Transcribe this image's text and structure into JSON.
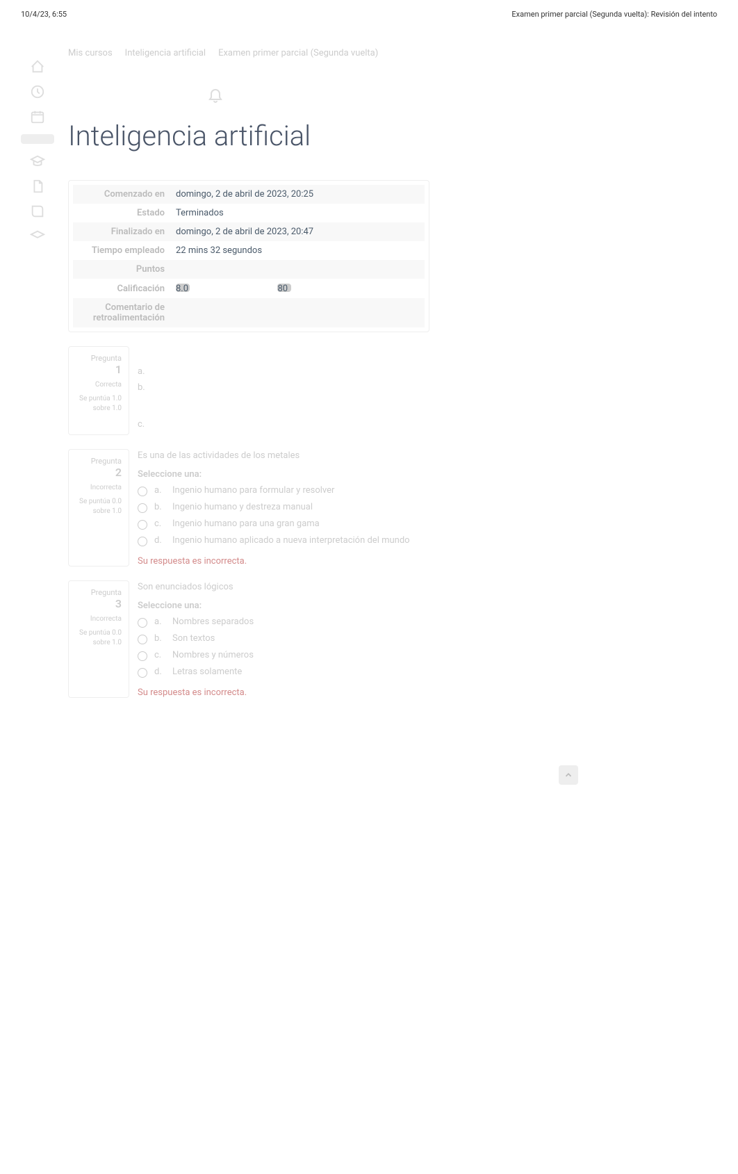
{
  "header": {
    "timestamp": "10/4/23, 6:55",
    "doc_title": "Examen primer parcial (Segunda vuelta): Revisión del intento"
  },
  "breadcrumbs": {
    "crumb1": "Mis cursos",
    "crumb2": "Inteligencia artificial",
    "crumb3": "Examen primer parcial (Segunda vuelta)"
  },
  "course": {
    "title": "Inteligencia artificial"
  },
  "summary": {
    "rows": [
      {
        "label": "Comenzado en",
        "value": "domingo, 2 de abril de 2023, 20:25"
      },
      {
        "label": "Estado",
        "value": "Terminados"
      },
      {
        "label": "Finalizado en",
        "value": "domingo, 2 de abril de 2023, 20:47"
      },
      {
        "label": "Tiempo empleado",
        "value": "22 mins 32 segundos"
      },
      {
        "label": "Puntos",
        "value": ""
      },
      {
        "label": "Calificación",
        "value1": "8.0",
        "value_mid": "",
        "value2": "80"
      },
      {
        "label": "Comentario de retroalimentación",
        "value": ""
      }
    ]
  },
  "q1": {
    "number": "1",
    "label": "Pregunta",
    "status1": "Correcta",
    "status2": "Se puntúa 1.0 sobre 1.0",
    "text_a": "a.",
    "text_b": "b.",
    "text_c": "c."
  },
  "q2": {
    "number": "2",
    "label": "Pregunta",
    "status1": "Incorrecta",
    "status2": "Se puntúa 0.0 sobre 1.0",
    "qtext": "Es una de las actividades de los metales",
    "heading": "Seleccione una:",
    "opts": {
      "a": {
        "let": "a.",
        "text": "Ingenio humano para formular y resolver"
      },
      "b": {
        "let": "b.",
        "text": "Ingenio humano y destreza manual"
      },
      "c": {
        "let": "c.",
        "text": "Ingenio humano para una gran gama"
      },
      "d": {
        "let": "d.",
        "text": "Ingenio humano aplicado a nueva interpretación del mundo"
      }
    },
    "feedback": "Su respuesta es incorrecta."
  },
  "q3": {
    "number": "3",
    "label": "Pregunta",
    "status1": "Incorrecta",
    "status2": "Se puntúa 0.0 sobre 1.0",
    "qtext": "Son enunciados lógicos",
    "heading": "Seleccione una:",
    "opts": {
      "a": {
        "let": "a.",
        "text": "Nombres separados"
      },
      "b": {
        "let": "b.",
        "text": "Son textos"
      },
      "c": {
        "let": "c.",
        "text": "Nombres y números"
      },
      "d": {
        "let": "d.",
        "text": "Letras solamente"
      }
    },
    "feedback": "Su respuesta es incorrecta."
  }
}
